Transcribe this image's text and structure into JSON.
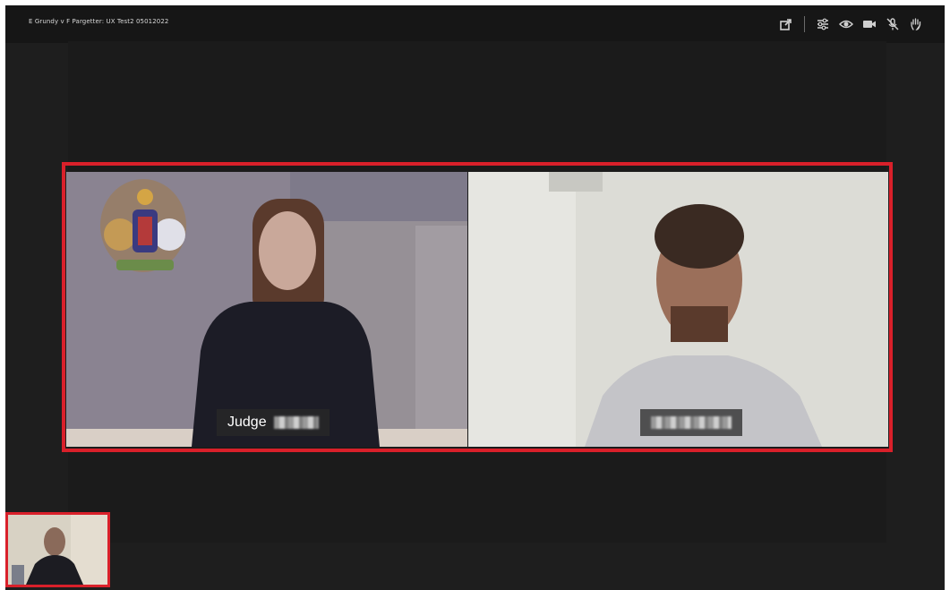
{
  "window": {
    "title": "E Grundy v F Pargetter: UX Test2 05012022"
  },
  "toolbar": {
    "icons": [
      "share-icon",
      "settings-icon",
      "eye-icon",
      "video-camera-icon",
      "mute-microphone-icon",
      "raise-hand-icon"
    ]
  },
  "participants": [
    {
      "role": "judge",
      "name_visible": "Judge"
    },
    {
      "role": "party",
      "name_visible": ""
    }
  ],
  "colors": {
    "highlight": "#d9202a",
    "background": "#1e1e1e",
    "topbar": "#161616"
  }
}
